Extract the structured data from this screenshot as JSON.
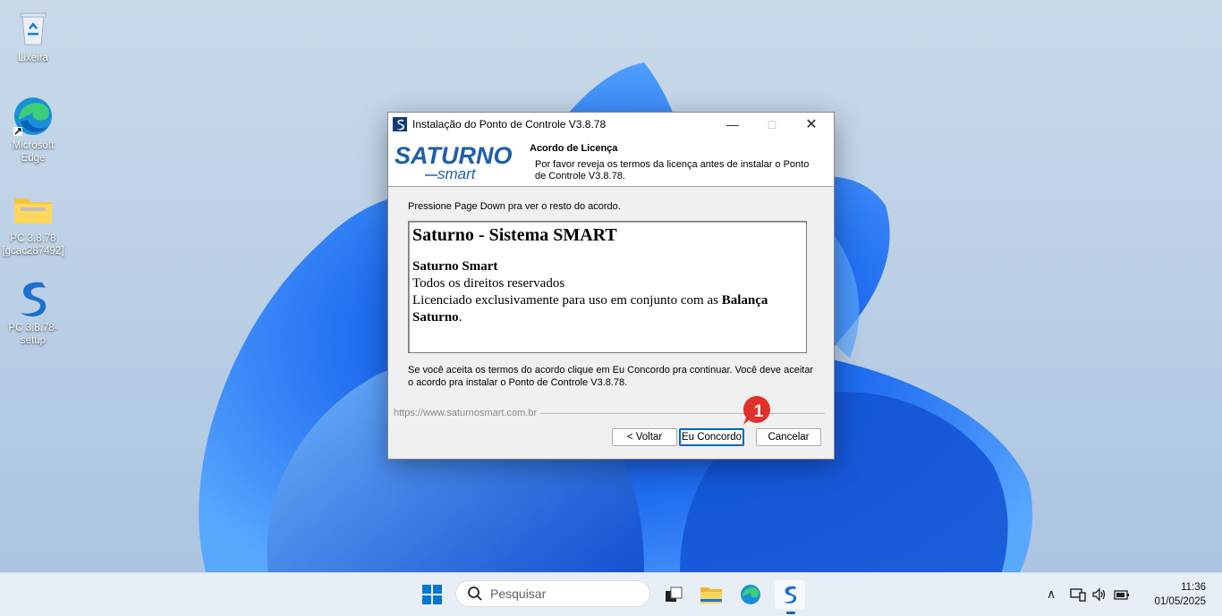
{
  "desktop": {
    "icons": [
      {
        "label": "Lixeira",
        "icon": "recycle-bin-icon"
      },
      {
        "label": "Microsoft Edge",
        "icon": "edge-icon"
      },
      {
        "label": "PC 3.8.78 [gcac287492]",
        "icon": "folder-zip-icon"
      },
      {
        "label": "PC 3.8.78-setup",
        "icon": "saturno-s-icon"
      }
    ]
  },
  "window": {
    "title": "Instalação do Ponto de Controle V3.8.78",
    "logo_text": "SATURNO",
    "logo_sub": "smart",
    "header_title": "Acordo de Licença",
    "header_subtitle": "Por favor reveja os termos da licença antes de instalar o Ponto de Controle V3.8.78.",
    "instruction": "Pressione Page Down pra ver o resto do acordo.",
    "license": {
      "heading": "Saturno - Sistema SMART",
      "company": "Saturno Smart",
      "rights": "Todos os direitos reservados",
      "licensed_prefix": "Licenciado exclusivamente para uso em conjunto com as ",
      "licensed_bold": "Balança Saturno",
      "licensed_suffix": "."
    },
    "accept_text": "Se você aceita os termos do acordo clique em Eu Concordo pra continuar. Você deve aceitar o acordo pra instalar o Ponto de Controle V3.8.78.",
    "url": "https://www.saturnosmart.com.br",
    "buttons": {
      "back": "< Voltar",
      "agree": "Eu Concordo",
      "cancel": "Cancelar"
    }
  },
  "step_badge": "1",
  "taskbar": {
    "search_placeholder": "Pesquisar",
    "time": "11:36",
    "date": "01/05/2025"
  },
  "colors": {
    "accent": "#0067c0",
    "badge": "#e0302b",
    "logo_blue": "#1f5fa8"
  }
}
